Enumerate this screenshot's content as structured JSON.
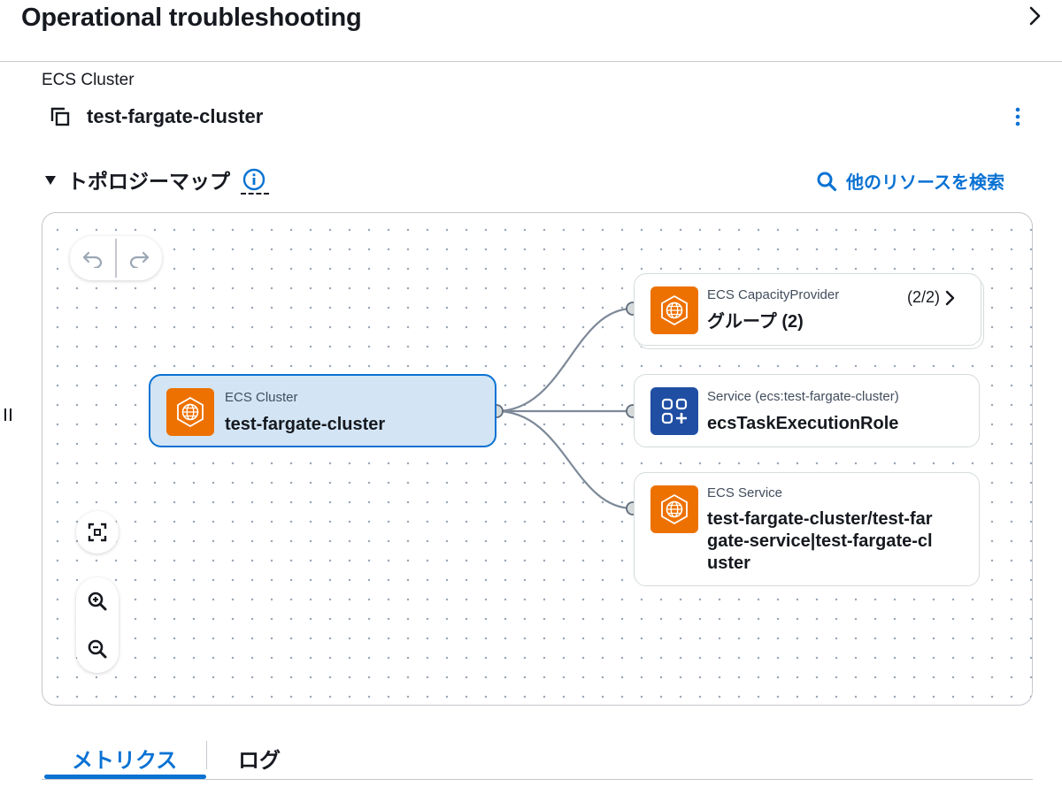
{
  "header": {
    "title": "Operational troubleshooting"
  },
  "resource": {
    "type_label": "ECS Cluster",
    "name": "test-fargate-cluster"
  },
  "topology": {
    "title": "トポロジーマップ",
    "search_link": "他のリソースを検索",
    "nodes": [
      {
        "type": "ECS Cluster",
        "name": "test-fargate-cluster",
        "icon": "ecs-globe-icon",
        "selected": true
      },
      {
        "type": "ECS CapacityProvider",
        "name": "グループ (2)",
        "count": "(2/2)",
        "icon": "ecs-globe-icon"
      },
      {
        "type": "Service (ecs:test-fargate-cluster)",
        "name": "ecsTaskExecutionRole",
        "icon": "service-grid-icon"
      },
      {
        "type": "ECS Service",
        "name": "test-fargate-cluster/test-far\ngate-service|test-fargate-cl\nuster",
        "icon": "ecs-globe-icon"
      }
    ]
  },
  "tabs": [
    {
      "label": "メトリクス",
      "active": true
    },
    {
      "label": "ログ",
      "active": false
    }
  ],
  "colors": {
    "accent": "#0972d3",
    "ecs_orange": "#ed7100",
    "service_blue": "#1f4ea3",
    "selected_bg": "#d3e5f5"
  }
}
